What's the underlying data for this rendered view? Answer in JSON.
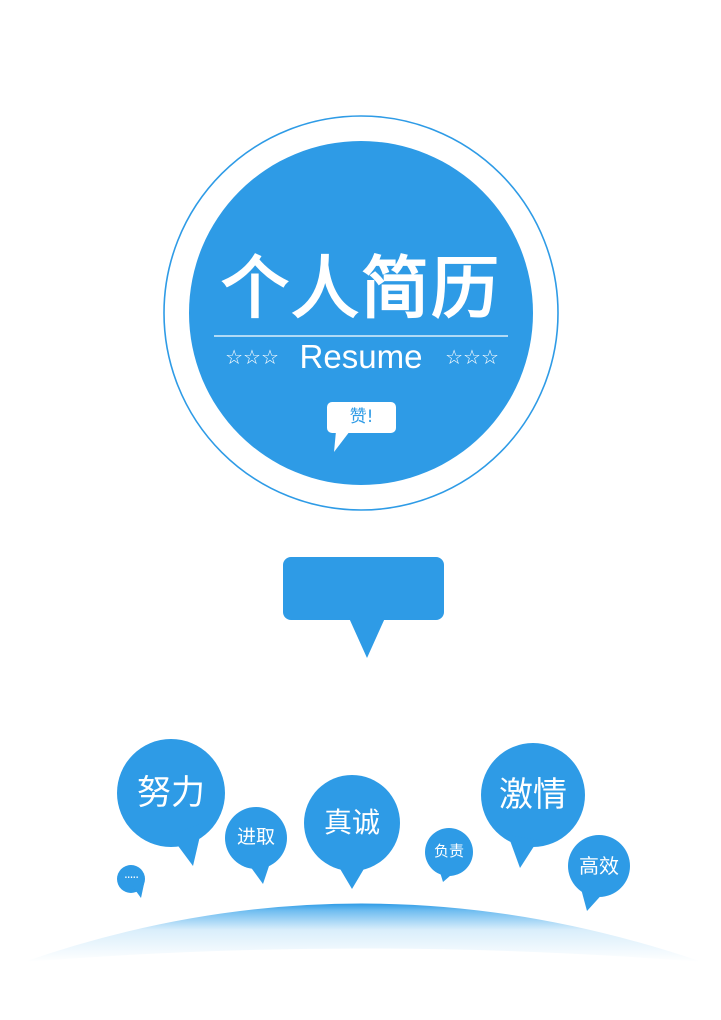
{
  "cover": {
    "title": "个人简历",
    "subtitle": "Resume",
    "stars_left": "☆☆☆",
    "stars_right": "☆☆☆",
    "badge": "赞!"
  },
  "keywords": {
    "nuli": "努力",
    "jinqu": "进取",
    "zhencheng": "真诚",
    "fuze": "负责",
    "jiqing": "激情",
    "gaoxiao": "高效",
    "dots": "....."
  },
  "colors": {
    "primary": "#2e9be6",
    "ring": "#2e9be6",
    "background": "#ffffff"
  }
}
